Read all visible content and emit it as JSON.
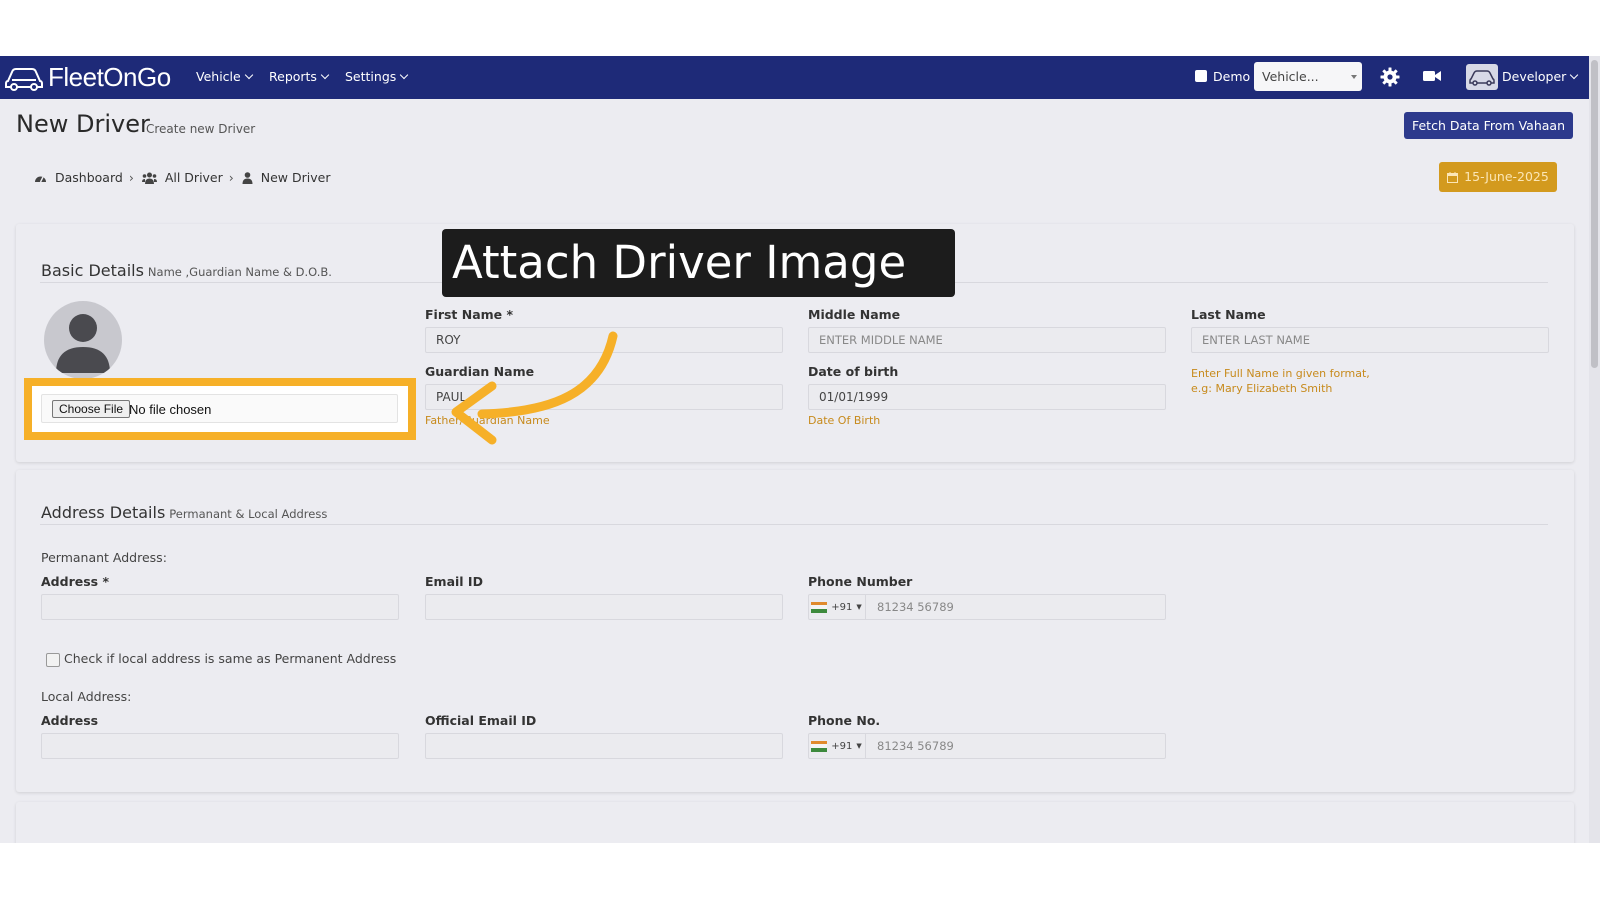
{
  "app": {
    "brand": "FleetOnGo"
  },
  "nav": {
    "items": [
      {
        "label": "Vehicle"
      },
      {
        "label": "Reports"
      },
      {
        "label": "Settings"
      }
    ],
    "demo_label": "Demo",
    "vehicle_select": "Vehicle...",
    "user_label": "Developer"
  },
  "page": {
    "title": "New Driver",
    "subtitle": "Create new Driver",
    "fetch_button": "Fetch Data From Vahaan",
    "date": "15-June-2025"
  },
  "breadcrumb": [
    {
      "label": "Dashboard",
      "icon": "dashboard-icon"
    },
    {
      "label": "All Driver",
      "icon": "users-icon"
    },
    {
      "label": "New Driver",
      "icon": "user-icon"
    }
  ],
  "basic": {
    "title": "Basic Details",
    "subtitle": "Name ,Guardian Name & D.O.B.",
    "file_button": "Choose File",
    "file_status": "No file chosen",
    "first_name": {
      "label": "First Name *",
      "value": "ROY"
    },
    "middle_name": {
      "label": "Middle Name",
      "placeholder": "ENTER MIDDLE NAME"
    },
    "last_name": {
      "label": "Last Name",
      "placeholder": "ENTER LAST NAME"
    },
    "guardian_name": {
      "label": "Guardian Name",
      "value": "PAUL",
      "hint": "Father/Guardian Name"
    },
    "dob": {
      "label": "Date of birth",
      "value": "01/01/1999",
      "hint": "Date Of Birth"
    },
    "name_hint_1": "Enter Full Name in given format,",
    "name_hint_2": "e.g: Mary Elizabeth Smith"
  },
  "address": {
    "title": "Address Details",
    "subtitle": "Permanant & Local Address",
    "permanent_heading": "Permanant Address:",
    "address_label": "Address *",
    "email_label": "Email ID",
    "phone_label": "Phone Number",
    "phone_code": "+91",
    "phone_placeholder": "81234 56789",
    "same_check_label": "Check if local address is same as Permanent Address",
    "local_heading": "Local Address:",
    "local_address_label": "Address",
    "official_email_label": "Official Email ID",
    "local_phone_label": "Phone No.",
    "local_phone_code": "+91",
    "local_phone_placeholder": "81234 56789"
  },
  "tooltip": {
    "text": "Attach Driver Image"
  },
  "colors": {
    "nav_bg": "#1e2a78",
    "accent": "#2d3a8c",
    "highlight": "#f6b028",
    "date_badge": "#d39a1e",
    "hint": "#c78a1c"
  }
}
